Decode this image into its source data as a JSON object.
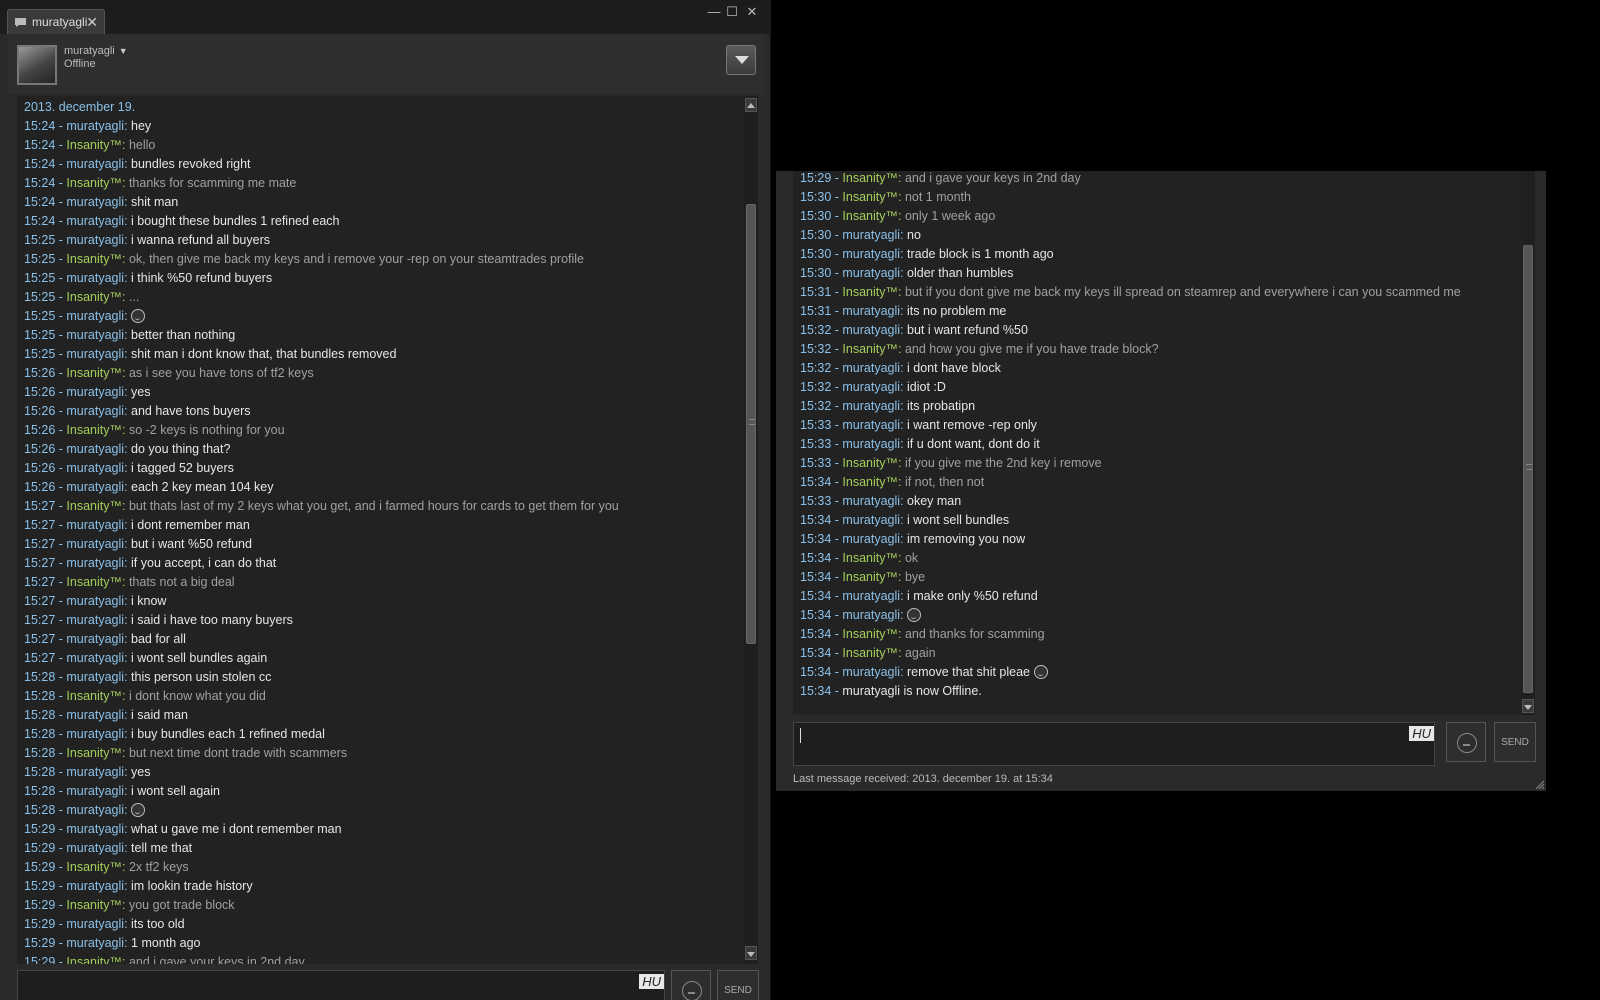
{
  "tab": {
    "title": "muratyagli",
    "close": "✕"
  },
  "window_controls": {
    "minimize": "—",
    "maximize": "☐",
    "close": "✕"
  },
  "profile": {
    "name": "muratyagli",
    "status": "Offline"
  },
  "input": {
    "lang": "HU",
    "send_label": "SEND"
  },
  "left_log": [
    {
      "date": "2013. december 19."
    },
    {
      "t": "15:24",
      "n": "muratyagli",
      "s": "m",
      "m": "hey"
    },
    {
      "t": "15:24",
      "n": "Insanity™",
      "s": "i",
      "m": "hello"
    },
    {
      "t": "15:24",
      "n": "muratyagli",
      "s": "m",
      "m": "bundles revoked right"
    },
    {
      "t": "15:24",
      "n": "Insanity™",
      "s": "i",
      "m": "thanks for scamming me mate"
    },
    {
      "t": "15:24",
      "n": "muratyagli",
      "s": "m",
      "m": "shit man"
    },
    {
      "t": "15:24",
      "n": "muratyagli",
      "s": "m",
      "m": "i bought these bundles 1 refined each"
    },
    {
      "t": "15:25",
      "n": "muratyagli",
      "s": "m",
      "m": "i wanna refund all buyers"
    },
    {
      "t": "15:25",
      "n": "Insanity™",
      "s": "i",
      "m": "ok, then give me back my keys and i remove your -rep on your steamtrades profile"
    },
    {
      "t": "15:25",
      "n": "muratyagli",
      "s": "m",
      "m": "i think %50 refund buyers"
    },
    {
      "t": "15:25",
      "n": "Insanity™",
      "s": "i",
      "m": "..."
    },
    {
      "t": "15:25",
      "n": "muratyagli",
      "s": "m",
      "m": "",
      "e": true
    },
    {
      "t": "15:25",
      "n": "muratyagli",
      "s": "m",
      "m": "better than nothing"
    },
    {
      "t": "15:25",
      "n": "muratyagli",
      "s": "m",
      "m": "shit man i dont know that, that bundles removed"
    },
    {
      "t": "15:26",
      "n": "Insanity™",
      "s": "i",
      "m": "as i see you have tons of tf2 keys"
    },
    {
      "t": "15:26",
      "n": "muratyagli",
      "s": "m",
      "m": "yes"
    },
    {
      "t": "15:26",
      "n": "muratyagli",
      "s": "m",
      "m": "and  have tons buyers"
    },
    {
      "t": "15:26",
      "n": "Insanity™",
      "s": "i",
      "m": "so -2 keys is nothing for you"
    },
    {
      "t": "15:26",
      "n": "muratyagli",
      "s": "m",
      "m": "do you  thing that?"
    },
    {
      "t": "15:26",
      "n": "muratyagli",
      "s": "m",
      "m": "i tagged 52 buyers"
    },
    {
      "t": "15:26",
      "n": "muratyagli",
      "s": "m",
      "m": "each 2 key mean 104 key"
    },
    {
      "t": "15:27",
      "n": "Insanity™",
      "s": "i",
      "m": "but thats last of my 2 keys what you get, and i farmed hours for cards to get them for you"
    },
    {
      "t": "15:27",
      "n": "muratyagli",
      "s": "m",
      "m": "i dont remember man"
    },
    {
      "t": "15:27",
      "n": "muratyagli",
      "s": "m",
      "m": "but  i want  %50 refund"
    },
    {
      "t": "15:27",
      "n": "muratyagli",
      "s": "m",
      "m": "if you accept, i can do that"
    },
    {
      "t": "15:27",
      "n": "Insanity™",
      "s": "i",
      "m": "thats not a big deal"
    },
    {
      "t": "15:27",
      "n": "muratyagli",
      "s": "m",
      "m": "i know"
    },
    {
      "t": "15:27",
      "n": "muratyagli",
      "s": "m",
      "m": "i said i have too many buyers"
    },
    {
      "t": "15:27",
      "n": "muratyagli",
      "s": "m",
      "m": "bad for all"
    },
    {
      "t": "15:27",
      "n": "muratyagli",
      "s": "m",
      "m": "i wont sell bundles again"
    },
    {
      "t": "15:28",
      "n": "muratyagli",
      "s": "m",
      "m": "this person usin stolen cc"
    },
    {
      "t": "15:28",
      "n": "Insanity™",
      "s": "i",
      "m": "i dont know what you did"
    },
    {
      "t": "15:28",
      "n": "muratyagli",
      "s": "m",
      "m": "i said man"
    },
    {
      "t": "15:28",
      "n": "muratyagli",
      "s": "m",
      "m": "i buy bundles each 1 refined medal"
    },
    {
      "t": "15:28",
      "n": "Insanity™",
      "s": "i",
      "m": "but next time dont trade with scammers"
    },
    {
      "t": "15:28",
      "n": "muratyagli",
      "s": "m",
      "m": "yes"
    },
    {
      "t": "15:28",
      "n": "muratyagli",
      "s": "m",
      "m": "i wont sell again"
    },
    {
      "t": "15:28",
      "n": "muratyagli",
      "s": "m",
      "m": "",
      "e": true
    },
    {
      "t": "15:29",
      "n": "muratyagli",
      "s": "m",
      "m": "what u gave me i dont remember man"
    },
    {
      "t": "15:29",
      "n": "muratyagli",
      "s": "m",
      "m": "tell me that"
    },
    {
      "t": "15:29",
      "n": "Insanity™",
      "s": "i",
      "m": "2x tf2 keys"
    },
    {
      "t": "15:29",
      "n": "muratyagli",
      "s": "m",
      "m": "im lookin trade history"
    },
    {
      "t": "15:29",
      "n": "Insanity™",
      "s": "i",
      "m": "you got trade block"
    },
    {
      "t": "15:29",
      "n": "muratyagli",
      "s": "m",
      "m": "its too old"
    },
    {
      "t": "15:29",
      "n": "muratyagli",
      "s": "m",
      "m": "1 month ago"
    },
    {
      "t": "15:29",
      "n": "Insanity™",
      "s": "i",
      "m": "and i gave your keys in 2nd day"
    }
  ],
  "right_log": [
    {
      "t": "15:29",
      "n": "Insanity™",
      "s": "i",
      "m": "and i gave your keys in 2nd day"
    },
    {
      "t": "15:30",
      "n": "Insanity™",
      "s": "i",
      "m": "not 1 month"
    },
    {
      "t": "15:30",
      "n": "Insanity™",
      "s": "i",
      "m": "only 1 week ago"
    },
    {
      "t": "15:30",
      "n": "muratyagli",
      "s": "m",
      "m": "no"
    },
    {
      "t": "15:30",
      "n": "muratyagli",
      "s": "m",
      "m": "trade block is 1 month ago"
    },
    {
      "t": "15:30",
      "n": "muratyagli",
      "s": "m",
      "m": "older than humbles"
    },
    {
      "t": "15:31",
      "n": "Insanity™",
      "s": "i",
      "m": "but if you dont give me back my keys ill spread on steamrep and everywhere i can you scammed me"
    },
    {
      "t": "15:31",
      "n": "muratyagli",
      "s": "m",
      "m": "its no problem me"
    },
    {
      "t": "15:32",
      "n": "muratyagli",
      "s": "m",
      "m": "but i want refund %50"
    },
    {
      "t": "15:32",
      "n": "Insanity™",
      "s": "i",
      "m": "and how you give me if you have trade block?"
    },
    {
      "t": "15:32",
      "n": "muratyagli",
      "s": "m",
      "m": "i dont have block"
    },
    {
      "t": "15:32",
      "n": "muratyagli",
      "s": "m",
      "m": "idiot :D"
    },
    {
      "t": "15:32",
      "n": "muratyagli",
      "s": "m",
      "m": "its probatipn"
    },
    {
      "t": "15:33",
      "n": "muratyagli",
      "s": "m",
      "m": "i want remove -rep only"
    },
    {
      "t": "15:33",
      "n": "muratyagli",
      "s": "m",
      "m": "if u dont want, dont do it"
    },
    {
      "t": "15:33",
      "n": "Insanity™",
      "s": "i",
      "m": "if you give me the 2nd key i remove"
    },
    {
      "t": "15:34",
      "n": "Insanity™",
      "s": "i",
      "m": "if not, then not"
    },
    {
      "t": "15:33",
      "n": "muratyagli",
      "s": "m",
      "m": "okey man"
    },
    {
      "t": "15:34",
      "n": "muratyagli",
      "s": "m",
      "m": "i wont sell bundles"
    },
    {
      "t": "15:34",
      "n": "muratyagli",
      "s": "m",
      "m": "im removing you now"
    },
    {
      "t": "15:34",
      "n": "Insanity™",
      "s": "i",
      "m": "ok"
    },
    {
      "t": "15:34",
      "n": "Insanity™",
      "s": "i",
      "m": "bye"
    },
    {
      "t": "15:34",
      "n": "muratyagli",
      "s": "m",
      "m": "i make only %50 refund"
    },
    {
      "t": "15:34",
      "n": "muratyagli",
      "s": "m",
      "m": "",
      "e": true
    },
    {
      "t": "15:34",
      "n": "Insanity™",
      "s": "i",
      "m": "and thanks for scamming"
    },
    {
      "t": "15:34",
      "n": "Insanity™",
      "s": "i",
      "m": "again"
    },
    {
      "t": "15:34",
      "n": "muratyagli",
      "s": "m",
      "m": "remove that shit pleae",
      "e": true
    },
    {
      "t": "15:34",
      "status": "muratyagli is now Offline."
    }
  ],
  "last_message": "Last message received: 2013. december 19. at 15:34",
  "colors": {
    "timestamp": "#8bc0e8",
    "friend_name": "#a4cf5b",
    "self_text": "#e6e6e6",
    "friend_text": "#a0a0a0"
  }
}
